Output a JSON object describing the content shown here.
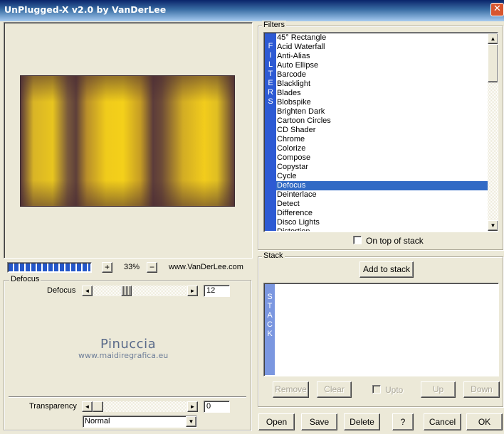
{
  "window": {
    "title": "UnPlugged-X v2.0 by VanDerLee",
    "close_glyph": "✕"
  },
  "preview": {
    "zoom": "33%",
    "zoom_in_glyph": "+",
    "zoom_out_glyph": "−",
    "website": "www.VanDerLee.com",
    "progress_percent": 100
  },
  "defocus": {
    "group_label": "Defocus",
    "param_label": "Defocus",
    "param_value": "12",
    "slider_fraction": 0.2,
    "watermark_title": "Pinuccia",
    "watermark_url": "www.maidiregrafica.eu"
  },
  "transparency": {
    "label": "Transparency",
    "value": "0",
    "slider_fraction": 0.0
  },
  "blend_mode": {
    "selected": "Normal"
  },
  "filters": {
    "group_label": "Filters",
    "side_tab_letters": [
      "F",
      "I",
      "L",
      "T",
      "E",
      "R",
      "S"
    ],
    "items": [
      "45° Rectangle",
      "Acid Waterfall",
      "Anti-Alias",
      "Auto Ellipse",
      "Barcode",
      "Blacklight",
      "Blades",
      "Blobspike",
      "Brighten Dark",
      "Cartoon Circles",
      "CD Shader",
      "Chrome",
      "Colorize",
      "Compose",
      "Copystar",
      "Cycle",
      "Defocus",
      "Deinterlace",
      "Detect",
      "Difference",
      "Disco Lights",
      "Distortion"
    ],
    "selected_index": 16,
    "on_top_label": "On top of stack"
  },
  "stack": {
    "group_label": "Stack",
    "add_label": "Add to stack",
    "side_tab_letters": [
      "S",
      "T",
      "A",
      "C",
      "K"
    ],
    "remove_label": "Remove",
    "clear_label": "Clear",
    "upto_label": "Upto",
    "up_label": "Up",
    "down_label": "Down"
  },
  "footer": {
    "open_label": "Open",
    "save_label": "Save",
    "delete_label": "Delete",
    "help_label": "?",
    "cancel_label": "Cancel",
    "ok_label": "OK"
  },
  "icons": {
    "arrow_left": "◄",
    "arrow_right": "►",
    "arrow_up": "▲",
    "arrow_down": "▼"
  },
  "colors": {
    "title_bar": "#0a246a",
    "selection": "#316ac5",
    "filters_tab": "#2d5ad3",
    "stack_tab": "#7b97e0",
    "close_button": "#d8552e"
  }
}
